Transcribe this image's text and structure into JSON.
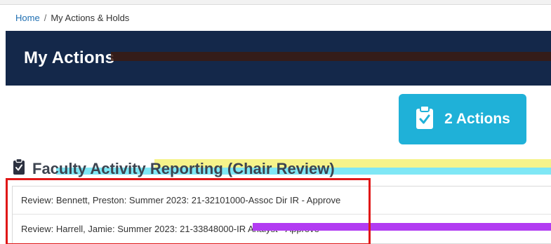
{
  "breadcrumb": {
    "home": "Home",
    "separator": "/",
    "current": "My Actions & Holds"
  },
  "header": {
    "title": "My Actions"
  },
  "actions_card": {
    "count_label": "2 Actions",
    "icon": "clipboard-check-icon",
    "color": "#1fb1d8"
  },
  "section": {
    "icon": "clipboard-check-icon",
    "title": "Faculty Activity Reporting (Chair Review)"
  },
  "items": [
    {
      "label": "Review: Bennett, Preston: Summer 2023: 21-32101000-Assoc Dir IR - Approve"
    },
    {
      "label": "Review: Harrell, Jamie: Summer 2023: 21-33848000-IR Analyst - Approve"
    }
  ],
  "colors": {
    "header_bg": "#14284a",
    "link": "#1f6fb2",
    "highlight": "#e01717"
  }
}
